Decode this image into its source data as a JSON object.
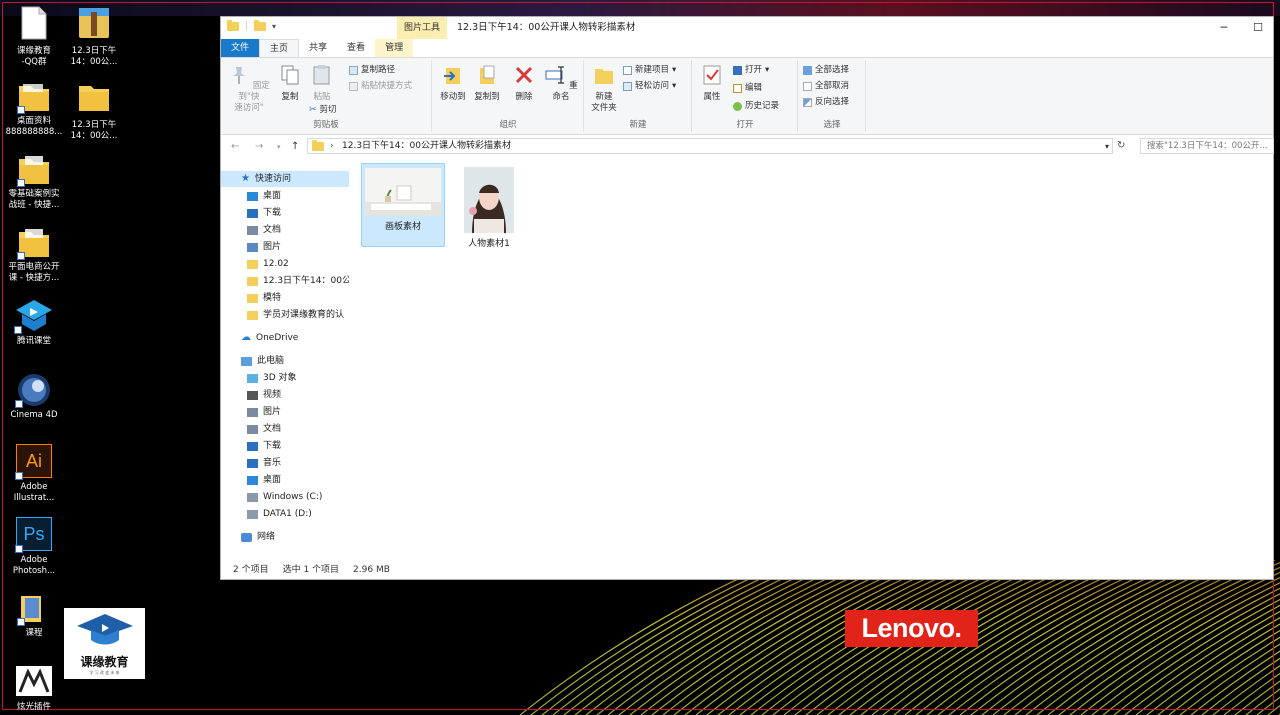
{
  "desktop": {
    "icons": [
      {
        "label": "课缘教育\n-QQ群",
        "icon": "document-icon"
      },
      {
        "label": "12.3日下午\n14：00公...",
        "icon": "archive-icon"
      },
      {
        "label": "桌面资料\n888888888...",
        "icon": "folder-icon"
      },
      {
        "label": "12.3日下午\n14：00公...",
        "icon": "folder-icon"
      },
      {
        "label": "零基础案例实\n战班 - 快捷...",
        "icon": "folder-shortcut-icon"
      },
      {
        "label": "平面电商公开\n课 - 快捷方...",
        "icon": "folder-shortcut-icon"
      },
      {
        "label": "腾讯课堂",
        "icon": "tencent-classroom-icon"
      },
      {
        "label": "Cinema 4D",
        "icon": "cinema4d-icon"
      },
      {
        "label": "Adobe\nIllustrat...",
        "icon": "illustrator-icon"
      },
      {
        "label": "Adobe\nPhotosh...",
        "icon": "photoshop-icon"
      },
      {
        "label": "课程",
        "icon": "folder-shortcut-icon"
      },
      {
        "label": "炫光插件",
        "icon": "plugin-icon"
      }
    ],
    "ai_glyph": "Ai",
    "ps_glyph": "Ps",
    "brand_logo_text": "Lenovo.",
    "watermark_logo_text": "课缘教育",
    "watermark_logo_sub": "学 习 改 变 未 来"
  },
  "explorer": {
    "window_title": "12.3日下午14：00公开课人物转彩描素材",
    "context_tool_label": "图片工具",
    "window_controls": {
      "minimize": "─",
      "maximize": "☐"
    },
    "tabs": [
      "文件",
      "主页",
      "共享",
      "查看",
      "管理"
    ],
    "ribbon": {
      "clipboard": {
        "label": "剪贴板",
        "pin_quick_access": "固定到\"快\n速访问\"",
        "copy": "复制",
        "paste": "粘贴",
        "copy_path": "复制路径",
        "paste_shortcut": "粘贴快捷方式",
        "cut": "剪切"
      },
      "organize": {
        "label": "组织",
        "move_to": "移动到",
        "copy_to": "复制到",
        "delete": "删除",
        "rename": "重命名"
      },
      "new": {
        "label": "新建",
        "new_folder": "新建\n文件夹",
        "new_item": "新建项目",
        "easy_access": "轻松访问"
      },
      "open": {
        "label": "打开",
        "properties": "属性",
        "open": "打开",
        "edit": "编辑",
        "history": "历史记录"
      },
      "select": {
        "label": "选择",
        "select_all": "全部选择",
        "select_none": "全部取消",
        "invert": "反向选择"
      }
    },
    "address": {
      "path": "12.3日下午14：00公开课人物转彩描素材",
      "search_placeholder": "搜索\"12.3日下午14：00公开..."
    },
    "nav": {
      "quick_access": "快速访问",
      "quick_items": [
        "桌面",
        "下载",
        "文档",
        "图片",
        "12.02",
        "12.3日下午14：00公",
        "模特",
        "学员对课缘教育的认"
      ],
      "onedrive": "OneDrive",
      "this_pc": "此电脑",
      "pc_items": [
        "3D 对象",
        "视频",
        "图片",
        "文档",
        "下载",
        "音乐",
        "桌面",
        "Windows (C:)",
        "DATA1 (D:)"
      ],
      "network": "网络"
    },
    "files": [
      {
        "name": "画板素材",
        "selected": true
      },
      {
        "name": "人物素材1",
        "selected": false
      }
    ],
    "status": {
      "count": "2 个项目",
      "selection": "选中 1 个项目",
      "size": "2.96 MB"
    }
  },
  "colors": {
    "accent": "#1979ca",
    "selection": "#cce8ff",
    "lenovo_red": "#e2231a",
    "folder_yellow": "#f5cf5b"
  }
}
